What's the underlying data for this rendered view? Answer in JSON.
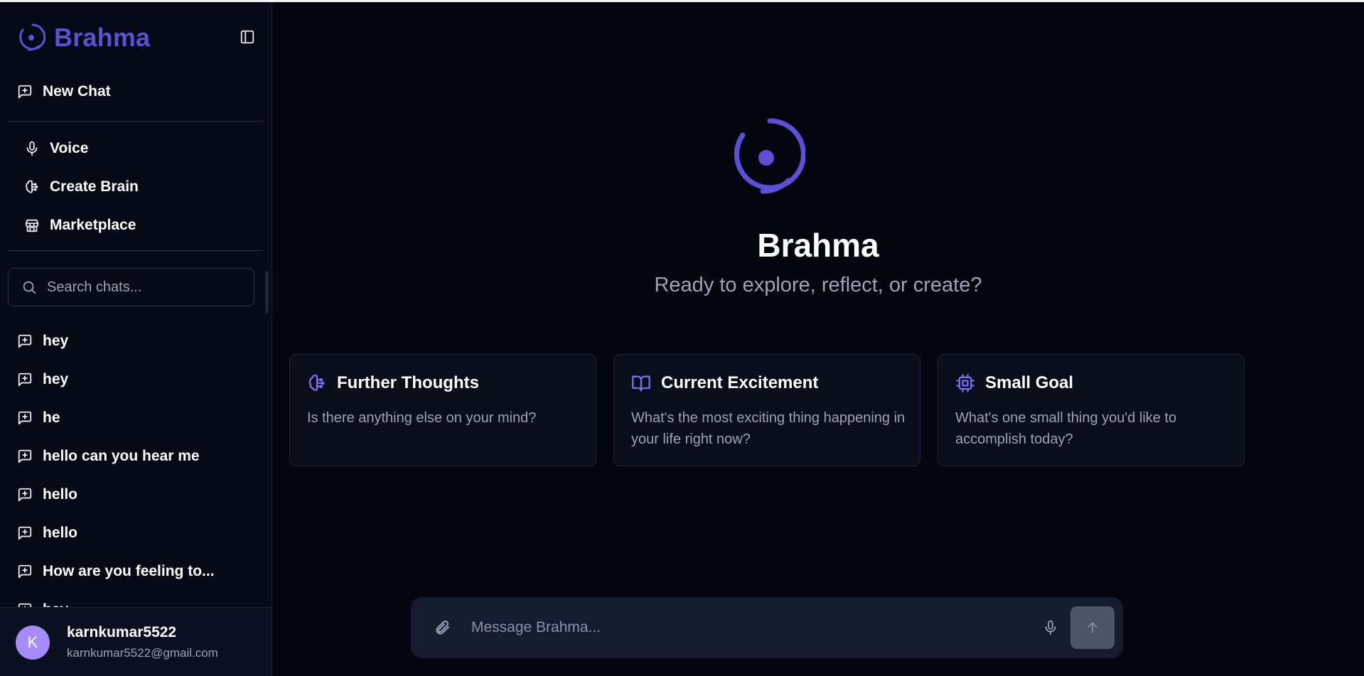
{
  "brand": {
    "name": "Brahma"
  },
  "sidebar": {
    "new_chat_label": "New Chat",
    "nav": [
      {
        "label": "Voice",
        "icon": "mic-icon"
      },
      {
        "label": "Create Brain",
        "icon": "brain-icon"
      },
      {
        "label": "Marketplace",
        "icon": "store-icon"
      }
    ],
    "search": {
      "placeholder": "Search chats..."
    },
    "chats": [
      "hey",
      "hey",
      "he",
      "hello can you hear me",
      "hello",
      "hello",
      "How are you feeling to...",
      "hey"
    ],
    "user": {
      "initial": "K",
      "name": "karnkumar5522",
      "email": "karnkumar5522@gmail.com"
    }
  },
  "main": {
    "title": "Brahma",
    "subtitle": "Ready to explore, reflect, or create?",
    "cards": [
      {
        "title": "Further Thoughts",
        "text": "Is there anything else on your mind?",
        "icon": "brain-icon"
      },
      {
        "title": "Current Excitement",
        "text": "What's the most exciting thing happening in your life right now?",
        "icon": "book-open-icon"
      },
      {
        "title": "Small Goal",
        "text": "What's one small thing you'd like to accomplish today?",
        "icon": "cpu-icon"
      }
    ],
    "composer": {
      "placeholder": "Message Brahma..."
    }
  },
  "colors": {
    "accent": "#5b50d6",
    "background": "#03060f",
    "sidebar": "#050a16",
    "muted_text": "#9aa3b8",
    "avatar": "#a78bfa"
  }
}
